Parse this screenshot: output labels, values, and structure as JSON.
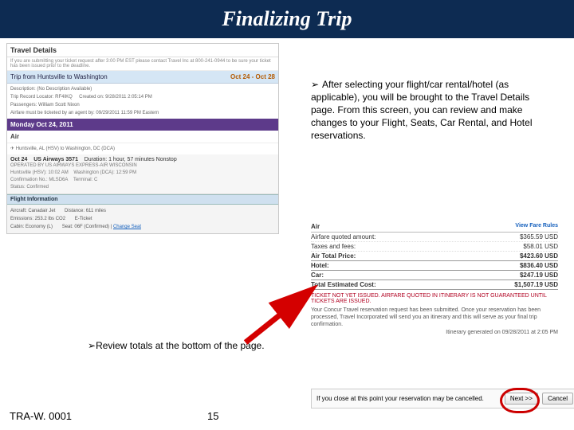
{
  "title": "Finalizing Trip",
  "bullets": {
    "b1": "After selecting your flight/car rental/hotel (as applicable), you will be brought to the Travel Details page. From this screen, you can review and make changes to your Flight, Seats, Car Rental, and Hotel reservations.",
    "b2": "Review totals at the bottom of the page."
  },
  "shot": {
    "header": "Travel Details",
    "note": "If you are submitting your ticket request after 3:00 PM EST please contact Travel Inc at 800-241-0944 to be sure your ticket has been issued prior to the deadline.",
    "trip_title": "Trip from Huntsville to Washington",
    "trip_dates": "Oct 24 - Oct 28",
    "desc_label": "Description:",
    "desc_value": "(No Description Available)",
    "rec_loc": "Trip Record Locator: RF4IKQ",
    "created": "Created on: 9/28/2011   2:05:14 PM",
    "passengers": "Passengers: William Scott Nixon",
    "agent": "Airfare must be ticketed by an agent by: 09/29/2011  11:59 PM Eastern",
    "daybar": "Monday Oct 24, 2011",
    "air_label": "Air",
    "route": "Huntsville, AL (HSV) to Washington, DC (DCA)",
    "seg_date": "Oct 24",
    "carrier": "US Airways 3571",
    "duration": "Duration: 1 hour, 57 minutes Nonstop",
    "operated": "OPERATED BY US AIRWAYS EXPRESS-AIR WISCONSIN",
    "dep": "Huntsville (HSV): 10:02 AM",
    "arr": "Washington (DCA): 12:59 PM",
    "conf": "Confirmation No.: MLSD6A",
    "term": "Terminal: C",
    "status": "Status: Confirmed",
    "fi_header": "Flight Information",
    "fi_aircraft": "Aircraft: Canadair Jet",
    "fi_dist": "Distance: 611 miles",
    "fi_emis": "Emissions: 253.2 lbs CO2",
    "fi_eticket": "E-Ticket",
    "fi_cabin": "Cabin: Economy (L)",
    "fi_seat": "Seat: 06F (Confirmed) | ",
    "fi_change": "Change Seat"
  },
  "costs": {
    "air_label": "Air",
    "fare_rules": "View Fare Rules",
    "airfare_l": "Airfare quoted amount:",
    "airfare_v": "$365.59 USD",
    "taxes_l": "Taxes and fees:",
    "taxes_v": "$58.01 USD",
    "airtotal_l": "Air Total Price:",
    "airtotal_v": "$423.60 USD",
    "hotel_l": "Hotel:",
    "hotel_v": "$836.40 USD",
    "car_l": "Car:",
    "car_v": "$247.19 USD",
    "tot_l": "Total Estimated Cost:",
    "tot_v": "$1,507.19 USD",
    "warn": "TICKET NOT YET ISSUED. AIRFARE QUOTED IN ITINERARY IS NOT GUARANTEED UNTIL TICKETS ARE ISSUED.",
    "blurb": "Your Concur Travel reservation request has been submitted. Once your reservation has been processed, Travel Incorporated will send you an itinerary and this will serve as your final trip confirmation.",
    "itn": "Itinerary generated on 09/28/2011 at 2:05 PM"
  },
  "closebar": {
    "msg": "If you close at this point your reservation may be cancelled.",
    "next": "Next >>",
    "cancel": "Cancel"
  },
  "footer": {
    "docid": "TRA-W. 0001",
    "page": "15"
  }
}
